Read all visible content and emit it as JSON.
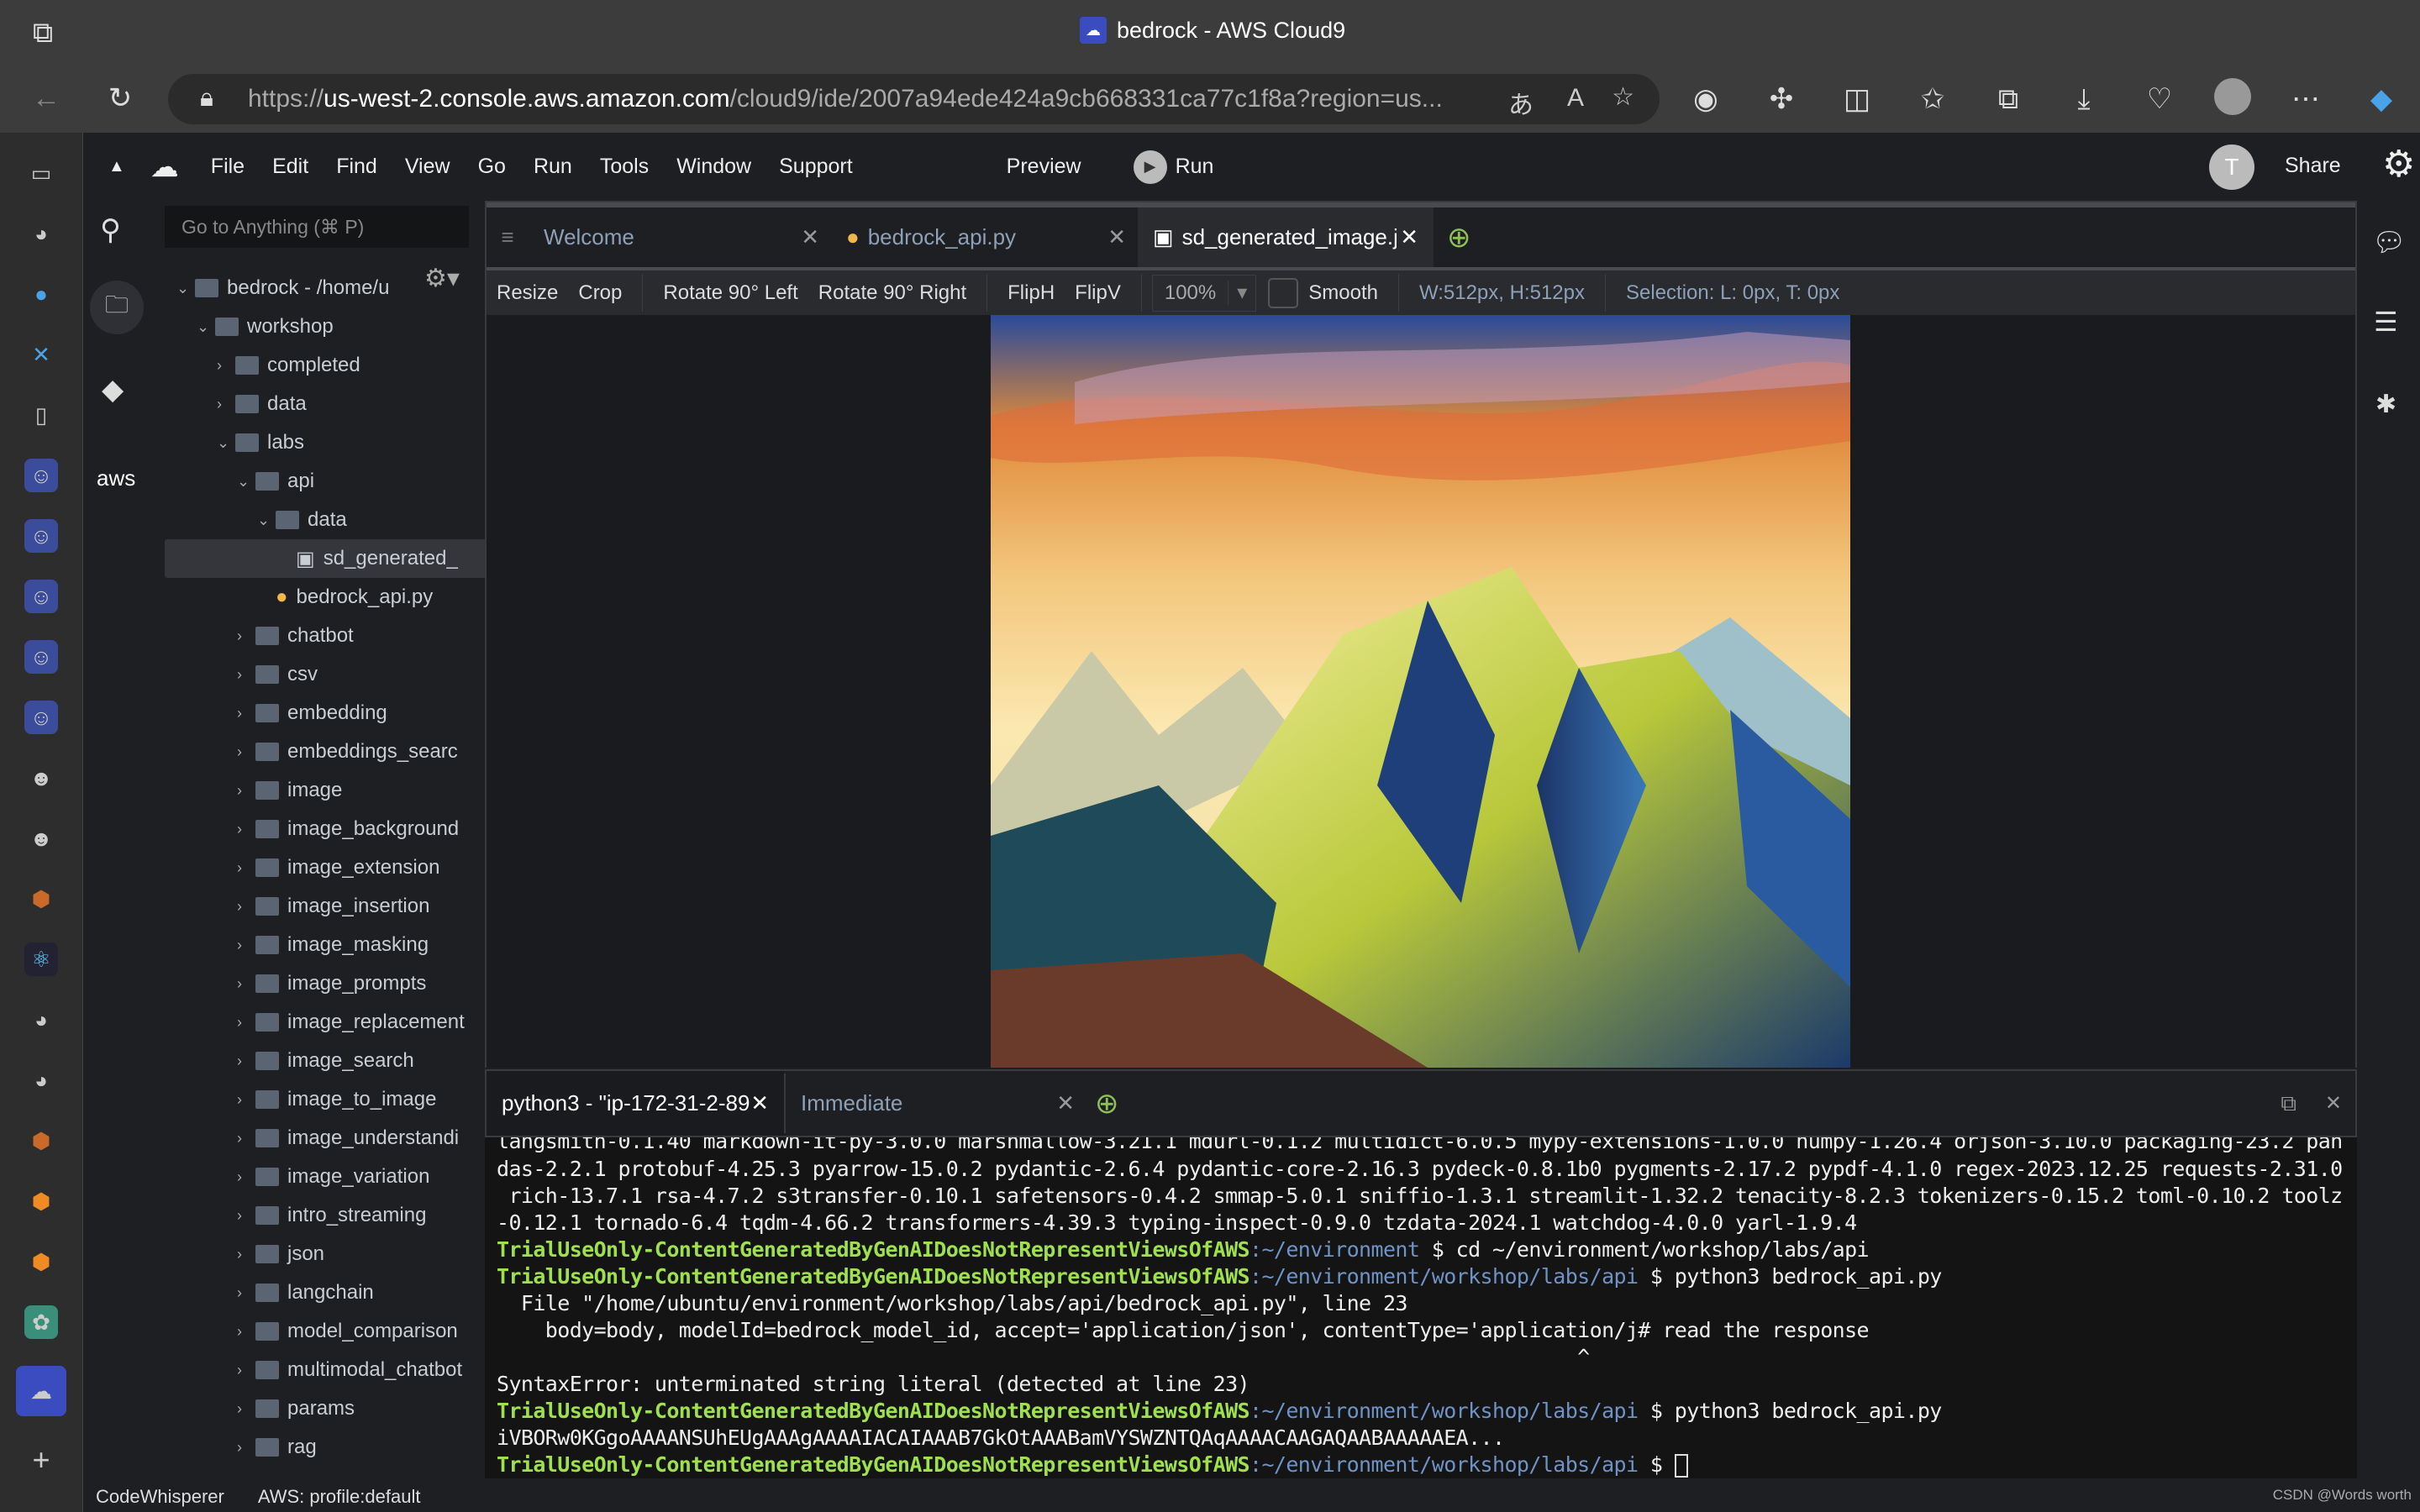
{
  "browser": {
    "tab_title": "bedrock - AWS Cloud9",
    "url_host_prefix": "https://",
    "url_host": "us-west-2.console.aws.amazon.com",
    "url_path": "/cloud9/ide/2007a94ede424a9cb668331ca77c1f8a?region=us..."
  },
  "menu": {
    "items": [
      "File",
      "Edit",
      "Find",
      "View",
      "Go",
      "Run",
      "Tools",
      "Window",
      "Support"
    ],
    "preview": "Preview",
    "run": "Run",
    "avatar": "T",
    "share": "Share"
  },
  "search": {
    "placeholder": "Go to Anything (⌘ P)"
  },
  "tree": {
    "root": "bedrock - /home/u",
    "items": [
      {
        "label": "workshop",
        "depth": 1,
        "type": "folder",
        "open": true
      },
      {
        "label": "completed",
        "depth": 2,
        "type": "folder"
      },
      {
        "label": "data",
        "depth": 2,
        "type": "folder"
      },
      {
        "label": "labs",
        "depth": 2,
        "type": "folder",
        "open": true
      },
      {
        "label": "api",
        "depth": 3,
        "type": "folder",
        "open": true
      },
      {
        "label": "data",
        "depth": 4,
        "type": "folder",
        "open": true
      },
      {
        "label": "sd_generated_",
        "depth": 5,
        "type": "image",
        "selected": true
      },
      {
        "label": "bedrock_api.py",
        "depth": 4,
        "type": "python"
      },
      {
        "label": "chatbot",
        "depth": 3,
        "type": "folder"
      },
      {
        "label": "csv",
        "depth": 3,
        "type": "folder"
      },
      {
        "label": "embedding",
        "depth": 3,
        "type": "folder"
      },
      {
        "label": "embeddings_searc",
        "depth": 3,
        "type": "folder"
      },
      {
        "label": "image",
        "depth": 3,
        "type": "folder"
      },
      {
        "label": "image_background",
        "depth": 3,
        "type": "folder"
      },
      {
        "label": "image_extension",
        "depth": 3,
        "type": "folder"
      },
      {
        "label": "image_insertion",
        "depth": 3,
        "type": "folder"
      },
      {
        "label": "image_masking",
        "depth": 3,
        "type": "folder"
      },
      {
        "label": "image_prompts",
        "depth": 3,
        "type": "folder"
      },
      {
        "label": "image_replacement",
        "depth": 3,
        "type": "folder"
      },
      {
        "label": "image_search",
        "depth": 3,
        "type": "folder"
      },
      {
        "label": "image_to_image",
        "depth": 3,
        "type": "folder"
      },
      {
        "label": "image_understandi",
        "depth": 3,
        "type": "folder"
      },
      {
        "label": "image_variation",
        "depth": 3,
        "type": "folder"
      },
      {
        "label": "intro_streaming",
        "depth": 3,
        "type": "folder"
      },
      {
        "label": "json",
        "depth": 3,
        "type": "folder"
      },
      {
        "label": "langchain",
        "depth": 3,
        "type": "folder"
      },
      {
        "label": "model_comparison",
        "depth": 3,
        "type": "folder"
      },
      {
        "label": "multimodal_chatbot",
        "depth": 3,
        "type": "folder"
      },
      {
        "label": "params",
        "depth": 3,
        "type": "folder"
      },
      {
        "label": "rag",
        "depth": 3,
        "type": "folder"
      }
    ]
  },
  "editor": {
    "tabs": [
      {
        "label": "Welcome"
      },
      {
        "label": "bedrock_api.py"
      },
      {
        "label": "sd_generated_image.jpg",
        "active": true
      }
    ],
    "toolbar": {
      "resize": "Resize",
      "crop": "Crop",
      "rot_left": "Rotate 90° Left",
      "rot_right": "Rotate 90° Right",
      "fliph": "FlipH",
      "flipv": "FlipV",
      "zoom": "100%",
      "smooth": "Smooth",
      "dims": "W:512px, H:512px",
      "selection": "Selection: L: 0px, T: 0px"
    }
  },
  "terminal": {
    "tabs": [
      {
        "label": "python3 - \"ip-172-31-2-89'"
      },
      {
        "label": "Immediate"
      }
    ],
    "lines": [
      {
        "text": "langsmith-0.1.40 markdown-it-py-3.0.0 marshmallow-3.21.1 mdurl-0.1.2 multidict-6.0.5 mypy-extensions-1.0.0 numpy-1.26.4 orjson-3.10.0 packaging-23.2 pan"
      },
      {
        "text": "das-2.2.1 protobuf-4.25.3 pyarrow-15.0.2 pydantic-2.6.4 pydantic-core-2.16.3 pydeck-0.8.1b0 pygments-2.17.2 pypdf-4.1.0 regex-2023.12.25 requests-2.31.0"
      },
      {
        "text": " rich-13.7.1 rsa-4.7.2 s3transfer-0.10.1 safetensors-0.4.2 smmap-5.0.1 sniffio-1.3.1 streamlit-1.32.2 tenacity-8.2.3 tokenizers-0.15.2 toml-0.10.2 toolz"
      },
      {
        "text": "-0.12.1 tornado-6.4 tqdm-4.66.2 transformers-4.39.3 typing-inspect-0.9.0 tzdata-2024.1 watchdog-4.0.0 yarl-1.9.4"
      },
      {
        "user": "TrialUseOnly-ContentGeneratedByGenAIDoesNotRepresentViewsOfAWS",
        "path": "~/environment",
        "cmd": " $ cd ~/environment/workshop/labs/api"
      },
      {
        "user": "TrialUseOnly-ContentGeneratedByGenAIDoesNotRepresentViewsOfAWS",
        "path": "~/environment/workshop/labs/api",
        "cmd": " $ python3 bedrock_api.py"
      },
      {
        "text": "  File \"/home/ubuntu/environment/workshop/labs/api/bedrock_api.py\", line 23"
      },
      {
        "text": "    body=body, modelId=bedrock_model_id, accept='application/json', contentType='application/j# read the response"
      },
      {
        "text": "                                                                                         ^"
      },
      {
        "text": "SyntaxError: unterminated string literal (detected at line 23)"
      },
      {
        "user": "TrialUseOnly-ContentGeneratedByGenAIDoesNotRepresentViewsOfAWS",
        "path": "~/environment/workshop/labs/api",
        "cmd": " $ python3 bedrock_api.py"
      },
      {
        "text": "iVBORw0KGgoAAAANSUhEUgAAAgAAAAIACAIAAAB7GkOtAAABamVYSWZNTQAqAAAACAAGAQAABAAAAAEA..."
      },
      {
        "user": "TrialUseOnly-ContentGeneratedByGenAIDoesNotRepresentViewsOfAWS",
        "path": "~/environment/workshop/labs/api",
        "cmd": " $ "
      }
    ]
  },
  "status": {
    "codewhisperer": "CodeWhisperer",
    "profile": "AWS: profile:default"
  },
  "watermark": "CSDN @Words worth",
  "colors": {
    "prompt_user": "#9fe04d",
    "prompt_path": "#6f93c6",
    "add_tab": "#8fbf5a"
  }
}
